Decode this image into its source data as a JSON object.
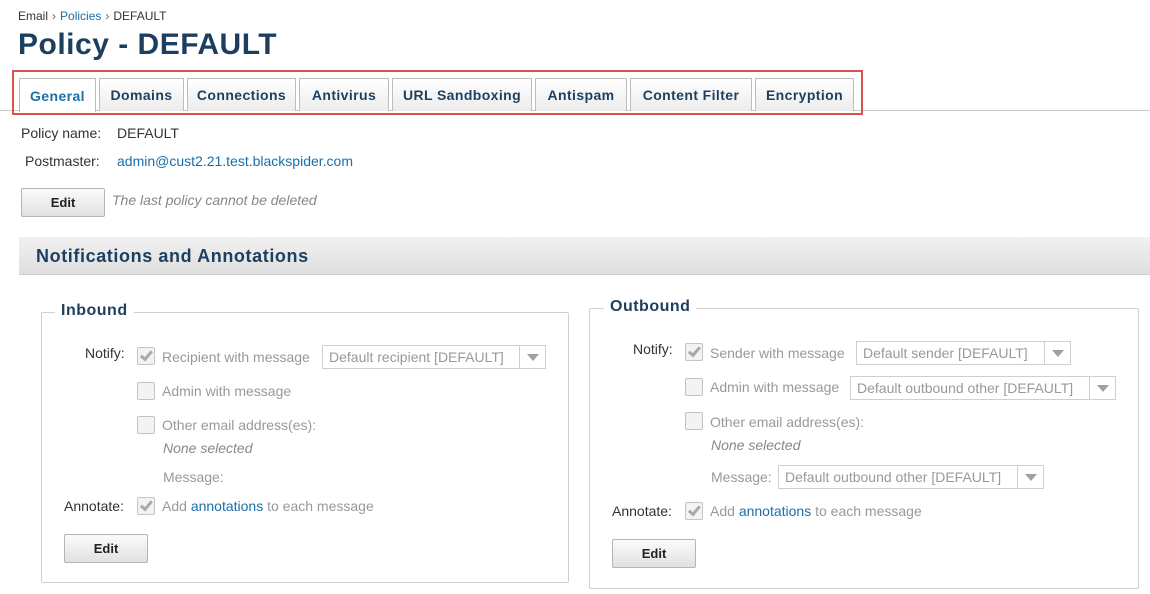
{
  "breadcrumb": {
    "root": "Email",
    "parent": "Policies",
    "current": "DEFAULT",
    "separator": "›"
  },
  "page": {
    "title": "Policy - DEFAULT"
  },
  "tabs": [
    {
      "label": "General",
      "active": true
    },
    {
      "label": "Domains"
    },
    {
      "label": "Connections"
    },
    {
      "label": "Antivirus"
    },
    {
      "label": "URL Sandboxing"
    },
    {
      "label": "Antispam"
    },
    {
      "label": "Content Filter"
    },
    {
      "label": "Encryption"
    }
  ],
  "policy": {
    "name_label": "Policy name:",
    "name_value": "DEFAULT",
    "postmaster_label": "Postmaster:",
    "postmaster_value": "admin@cust2.21.test.blackspider.com",
    "edit_label": "Edit",
    "delete_note": "The last policy cannot be deleted"
  },
  "section": {
    "title": "Notifications and Annotations"
  },
  "inbound": {
    "legend": "Inbound",
    "notify_label": "Notify:",
    "recipient_label": "Recipient with message",
    "recipient_checked": true,
    "recipient_select": "Default recipient [DEFAULT]",
    "admin_label": "Admin with message",
    "admin_checked": false,
    "other_label": "Other email address(es):",
    "other_checked": false,
    "none_selected": "None selected",
    "message_label": "Message:",
    "annotate_label": "Annotate:",
    "annotate_checked": true,
    "annotate_prefix": "Add",
    "annotate_link": "annotations",
    "annotate_suffix": "to each message",
    "edit_label": "Edit"
  },
  "outbound": {
    "legend": "Outbound",
    "notify_label": "Notify:",
    "sender_label": "Sender with message",
    "sender_checked": true,
    "sender_select": "Default sender [DEFAULT]",
    "admin_label": "Admin with message",
    "admin_checked": false,
    "admin_select": "Default outbound other [DEFAULT]",
    "other_label": "Other email address(es):",
    "other_checked": false,
    "none_selected": "None selected",
    "message_label": "Message:",
    "message_select": "Default outbound other [DEFAULT]",
    "annotate_label": "Annotate:",
    "annotate_checked": true,
    "annotate_prefix": "Add",
    "annotate_link": "annotations",
    "annotate_suffix": "to each message",
    "edit_label": "Edit"
  },
  "colors": {
    "title": "#1d3f5f",
    "link": "#1a6fa8",
    "highlight": "#d9534f"
  }
}
